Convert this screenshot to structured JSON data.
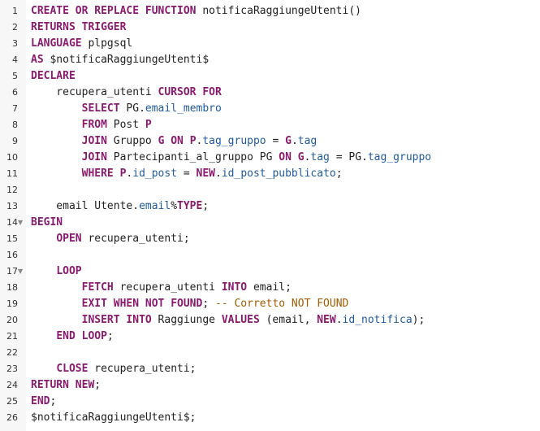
{
  "editor": {
    "lines": [
      {
        "num": "1",
        "fold": "",
        "tokens": [
          [
            "kw",
            "CREATE OR REPLACE FUNCTION"
          ],
          [
            "pl",
            " notificaRaggiungeUtenti()"
          ]
        ]
      },
      {
        "num": "2",
        "fold": "",
        "tokens": [
          [
            "kw",
            "RETURNS TRIGGER"
          ]
        ]
      },
      {
        "num": "3",
        "fold": "",
        "tokens": [
          [
            "kw",
            "LANGUAGE"
          ],
          [
            "pl",
            " plpgsql"
          ]
        ]
      },
      {
        "num": "4",
        "fold": "",
        "tokens": [
          [
            "kw",
            "AS"
          ],
          [
            "pl",
            " $notificaRaggiungeUtenti$"
          ]
        ]
      },
      {
        "num": "5",
        "fold": "",
        "tokens": [
          [
            "kw",
            "DECLARE"
          ]
        ]
      },
      {
        "num": "6",
        "fold": "",
        "tokens": [
          [
            "pl",
            "    recupera_utenti "
          ],
          [
            "kw",
            "CURSOR FOR"
          ]
        ]
      },
      {
        "num": "7",
        "fold": "",
        "tokens": [
          [
            "pl",
            "        "
          ],
          [
            "kw",
            "SELECT"
          ],
          [
            "pl",
            " PG."
          ],
          [
            "bi",
            "email_membro"
          ]
        ]
      },
      {
        "num": "8",
        "fold": "",
        "tokens": [
          [
            "pl",
            "        "
          ],
          [
            "kw",
            "FROM"
          ],
          [
            "pl",
            " Post "
          ],
          [
            "kw",
            "P"
          ]
        ]
      },
      {
        "num": "9",
        "fold": "",
        "tokens": [
          [
            "pl",
            "        "
          ],
          [
            "kw",
            "JOIN"
          ],
          [
            "pl",
            " Gruppo "
          ],
          [
            "kw",
            "G ON P"
          ],
          [
            "pl",
            "."
          ],
          [
            "bi",
            "tag_gruppo"
          ],
          [
            "pl",
            " = "
          ],
          [
            "kw",
            "G"
          ],
          [
            "pl",
            "."
          ],
          [
            "bi",
            "tag"
          ]
        ]
      },
      {
        "num": "10",
        "fold": "",
        "tokens": [
          [
            "pl",
            "        "
          ],
          [
            "kw",
            "JOIN"
          ],
          [
            "pl",
            " Partecipanti_al_gruppo PG "
          ],
          [
            "kw",
            "ON G"
          ],
          [
            "pl",
            "."
          ],
          [
            "bi",
            "tag"
          ],
          [
            "pl",
            " = PG."
          ],
          [
            "bi",
            "tag_gruppo"
          ]
        ]
      },
      {
        "num": "11",
        "fold": "",
        "tokens": [
          [
            "pl",
            "        "
          ],
          [
            "kw",
            "WHERE P"
          ],
          [
            "pl",
            "."
          ],
          [
            "bi",
            "id_post"
          ],
          [
            "pl",
            " = "
          ],
          [
            "kw",
            "NEW"
          ],
          [
            "pl",
            "."
          ],
          [
            "bi",
            "id_post_pubblicato"
          ],
          [
            "pl",
            ";"
          ]
        ]
      },
      {
        "num": "12",
        "fold": "",
        "tokens": []
      },
      {
        "num": "13",
        "fold": "",
        "tokens": [
          [
            "pl",
            "    email Utente."
          ],
          [
            "bi",
            "email"
          ],
          [
            "pl",
            "%"
          ],
          [
            "kw",
            "TYPE"
          ],
          [
            "pl",
            ";"
          ]
        ]
      },
      {
        "num": "14",
        "fold": "▼",
        "tokens": [
          [
            "kw",
            "BEGIN"
          ]
        ]
      },
      {
        "num": "15",
        "fold": "",
        "tokens": [
          [
            "pl",
            "    "
          ],
          [
            "kw",
            "OPEN"
          ],
          [
            "pl",
            " recupera_utenti;"
          ]
        ]
      },
      {
        "num": "16",
        "fold": "",
        "tokens": []
      },
      {
        "num": "17",
        "fold": "▼",
        "tokens": [
          [
            "pl",
            "    "
          ],
          [
            "kw",
            "LOOP"
          ]
        ]
      },
      {
        "num": "18",
        "fold": "",
        "tokens": [
          [
            "pl",
            "        "
          ],
          [
            "kw",
            "FETCH"
          ],
          [
            "pl",
            " recupera_utenti "
          ],
          [
            "kw",
            "INTO"
          ],
          [
            "pl",
            " email;"
          ]
        ]
      },
      {
        "num": "19",
        "fold": "",
        "tokens": [
          [
            "pl",
            "        "
          ],
          [
            "kw",
            "EXIT WHEN NOT FOUND"
          ],
          [
            "pl",
            "; "
          ],
          [
            "cm",
            "-- Corretto NOT FOUND"
          ]
        ]
      },
      {
        "num": "20",
        "fold": "",
        "tokens": [
          [
            "pl",
            "        "
          ],
          [
            "kw",
            "INSERT INTO"
          ],
          [
            "pl",
            " Raggiunge "
          ],
          [
            "kw",
            "VALUES"
          ],
          [
            "pl",
            " (email, "
          ],
          [
            "kw",
            "NEW"
          ],
          [
            "pl",
            "."
          ],
          [
            "bi",
            "id_notifica"
          ],
          [
            "pl",
            ");"
          ]
        ]
      },
      {
        "num": "21",
        "fold": "",
        "tokens": [
          [
            "pl",
            "    "
          ],
          [
            "kw",
            "END LOOP"
          ],
          [
            "pl",
            ";"
          ]
        ]
      },
      {
        "num": "22",
        "fold": "",
        "tokens": []
      },
      {
        "num": "23",
        "fold": "",
        "tokens": [
          [
            "pl",
            "    "
          ],
          [
            "kw",
            "CLOSE"
          ],
          [
            "pl",
            " recupera_utenti;"
          ]
        ]
      },
      {
        "num": "24",
        "fold": "",
        "tokens": [
          [
            "kw",
            "RETURN NEW"
          ],
          [
            "pl",
            ";"
          ]
        ]
      },
      {
        "num": "25",
        "fold": "",
        "tokens": [
          [
            "kw",
            "END"
          ],
          [
            "pl",
            ";"
          ]
        ]
      },
      {
        "num": "26",
        "fold": "",
        "tokens": [
          [
            "pl",
            "$notificaRaggiungeUtenti$;"
          ]
        ]
      }
    ]
  }
}
